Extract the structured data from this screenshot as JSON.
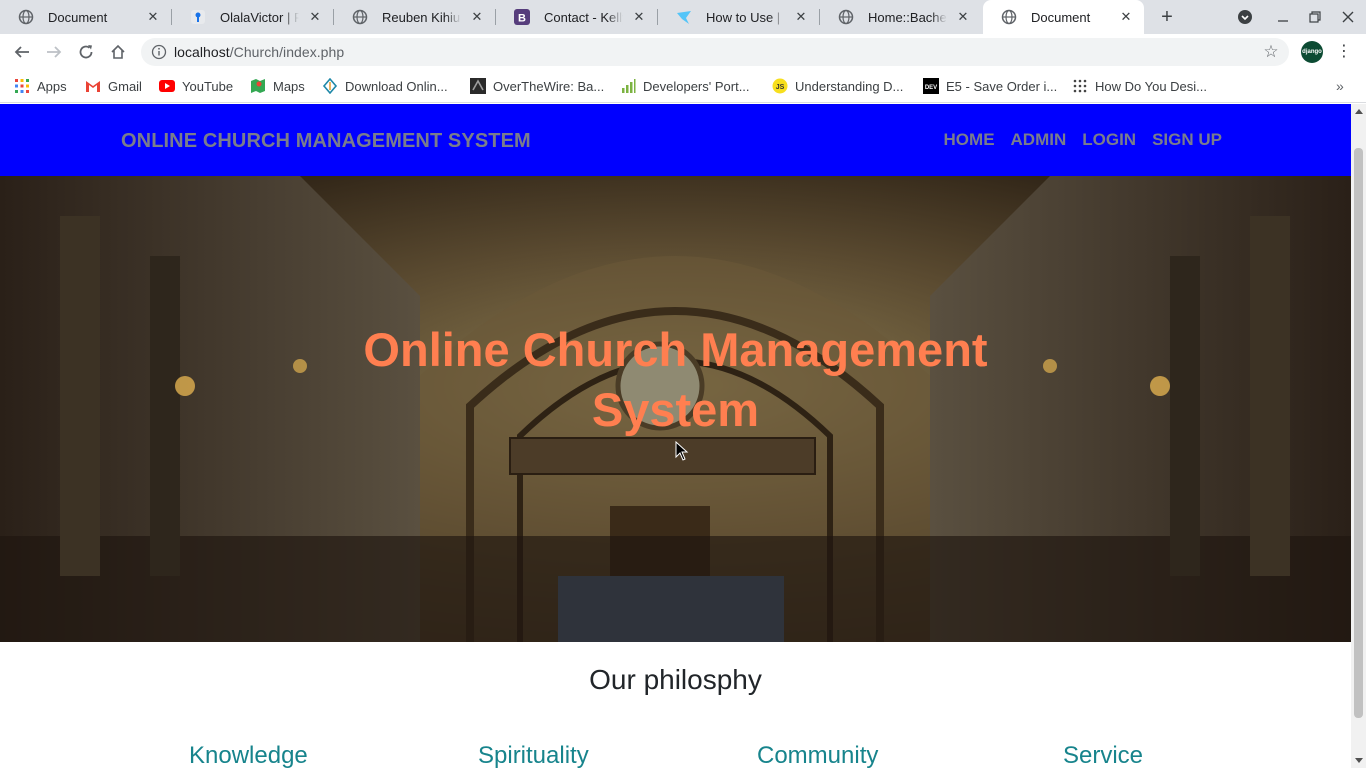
{
  "browser": {
    "tabs": [
      {
        "title": "Document",
        "icon": "globe-icon",
        "active": false
      },
      {
        "title": "OlalaVictor | Full",
        "icon": "person-icon",
        "active": false
      },
      {
        "title": "Reuben Kihiu",
        "icon": "globe-icon",
        "active": false
      },
      {
        "title": "Contact - Kelly B",
        "icon": "bootstrap-icon",
        "active": false
      },
      {
        "title": "How to Use | Icof",
        "icon": "bird-icon",
        "active": false
      },
      {
        "title": "Home::Bachem S",
        "icon": "globe-icon",
        "active": false
      },
      {
        "title": "Document",
        "icon": "globe-icon",
        "active": true
      }
    ],
    "address": {
      "host": "localhost",
      "path": "/Church/index.php"
    },
    "profile_label": "django",
    "bookmarks": [
      {
        "label": "Apps",
        "icon": "apps-grid-icon"
      },
      {
        "label": "Gmail",
        "icon": "gmail-icon"
      },
      {
        "label": "YouTube",
        "icon": "youtube-icon"
      },
      {
        "label": "Maps",
        "icon": "maps-icon"
      },
      {
        "label": "Download Onlin...",
        "icon": "download-icon"
      },
      {
        "label": "OverTheWire: Ba...",
        "icon": "otw-icon"
      },
      {
        "label": "Developers' Port...",
        "icon": "signal-bars-icon"
      },
      {
        "label": "Understanding D...",
        "icon": "js-icon"
      },
      {
        "label": "E5 - Save Order i...",
        "icon": "dev-icon"
      },
      {
        "label": "How Do You Desi...",
        "icon": "dots-grid-icon"
      }
    ]
  },
  "site": {
    "brand": "ONLINE CHURCH MANAGEMENT SYSTEM",
    "nav": [
      "HOME",
      "ADMIN",
      "LOGIN",
      "SIGN UP"
    ],
    "hero_title": "Online Church Management System",
    "section_title": "Our philosphy",
    "pillars": [
      "Knowledge",
      "Spirituality",
      "Community",
      "Service"
    ],
    "colors": {
      "nav_bg": "#0000ff",
      "nav_text": "#7a7d8c",
      "hero_title": "#ff7f50",
      "pillar": "#17848c"
    }
  }
}
